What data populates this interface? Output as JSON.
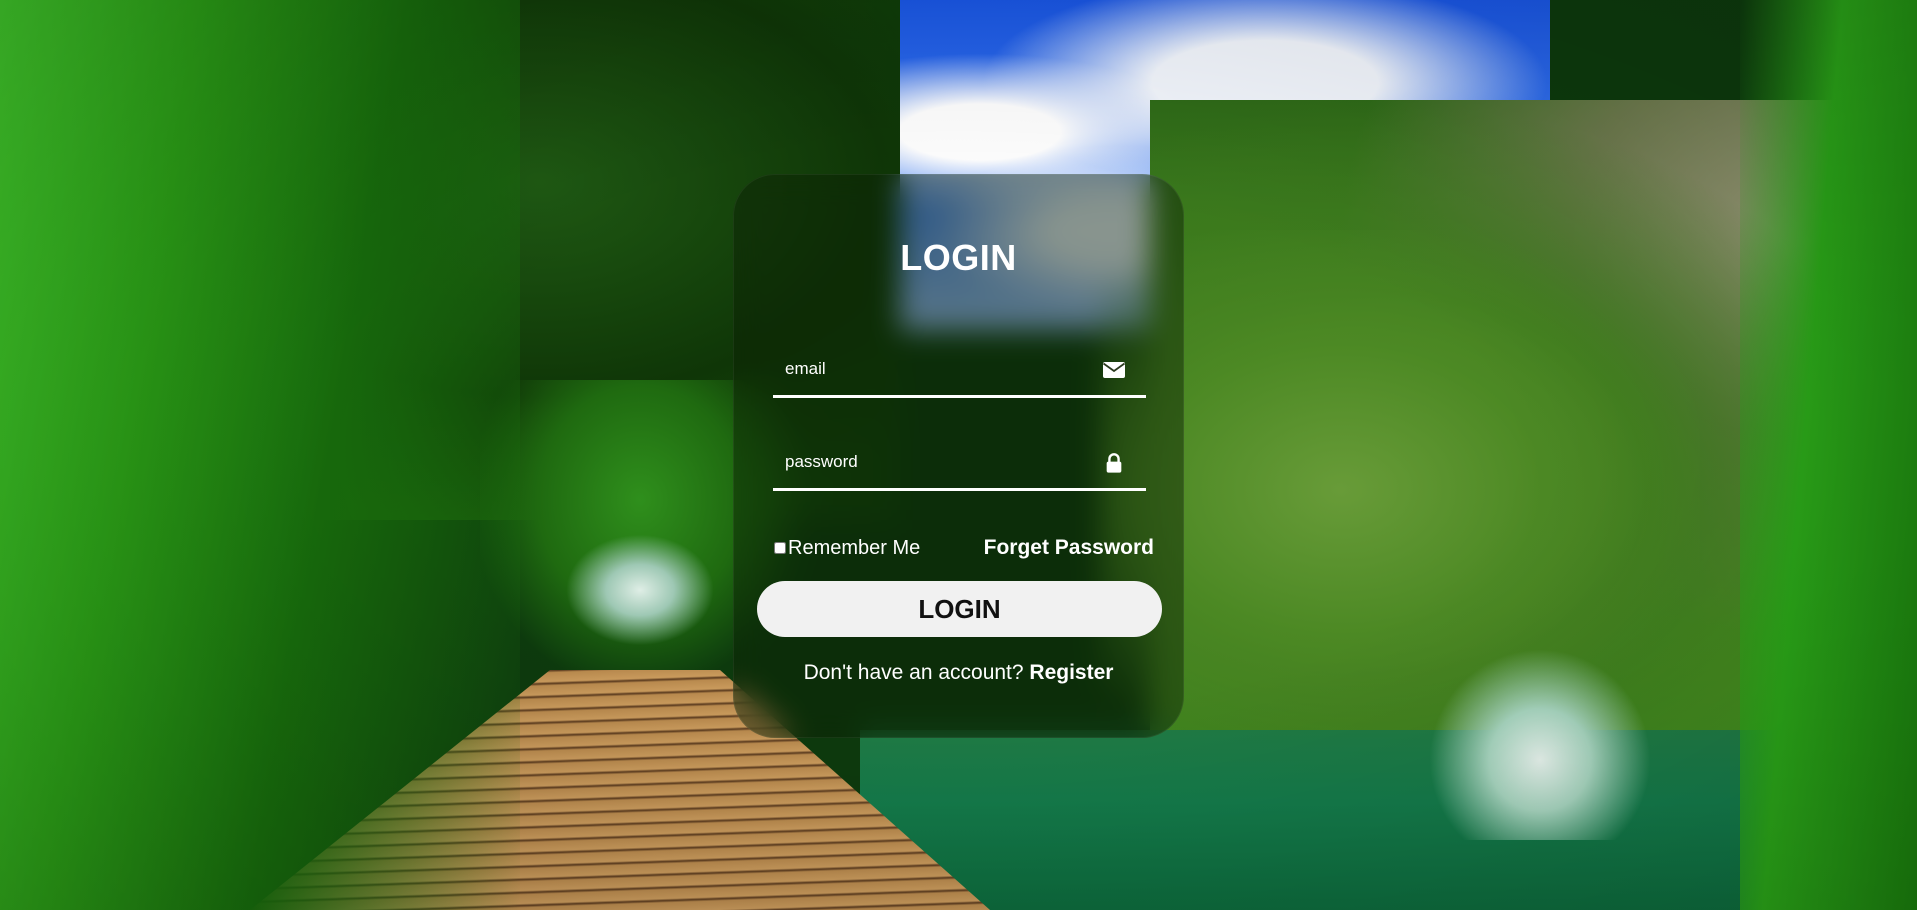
{
  "login_form": {
    "title": "LOGIN",
    "email": {
      "placeholder": "email",
      "value": "",
      "icon": "envelope-icon"
    },
    "password": {
      "placeholder": "password",
      "value": "",
      "icon": "lock-icon"
    },
    "remember_me": {
      "label": "Remember Me",
      "checked": false
    },
    "forget_password_label": "Forget Password",
    "submit_label": "LOGIN",
    "register_prompt": "Don't have an account?",
    "register_label": "Register"
  },
  "background": {
    "description_icon": "nature-background-image"
  }
}
